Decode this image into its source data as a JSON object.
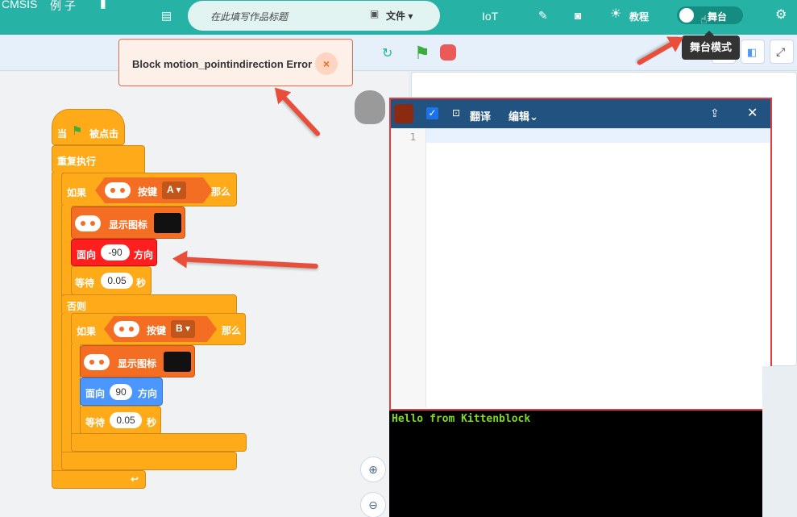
{
  "topbar": {
    "brand": "CMSIS",
    "examples": "例 子",
    "title_placeholder": "在此填写作品标题",
    "file_menu": "文件",
    "iot": "IoT",
    "tutorial": "教程",
    "stage_toggle": "舞台"
  },
  "tooltip": "舞台模式",
  "error": {
    "message": "Block motion_pointindirection Error",
    "close": "×"
  },
  "blocks": {
    "when_flag_prefix": "当",
    "when_flag_suffix": "被点击",
    "forever": "重复执行",
    "if1": "如果",
    "button1": "按键",
    "key_a": "A ▾",
    "then1": "那么",
    "show_icon1": "显示图标",
    "point_dir1": "面向",
    "dir_value1": "-90",
    "direction1": "方向",
    "wait1": "等待",
    "wait_val1": "0.05",
    "sec1": "秒",
    "else": "否则",
    "if2": "如果",
    "button2": "按键",
    "key_b": "B ▾",
    "then2": "那么",
    "show_icon2": "显示图标",
    "point_dir2": "面向",
    "dir_value2": "90",
    "direction2": "方向",
    "wait2": "等待",
    "wait_val2": "0.05",
    "sec2": "秒"
  },
  "code_window": {
    "translate": "翻译",
    "edit": "编辑",
    "line_number": "1",
    "terminal_output": "Hello from Kittenblock"
  },
  "colors": {
    "topbar": "#26b3a6",
    "events": "#ffab19",
    "microbit": "#f36e22",
    "error_block": "#ff1f1f",
    "motion": "#4c97ff",
    "code_header": "#22527f",
    "terminal_text": "#7ddc1f"
  }
}
